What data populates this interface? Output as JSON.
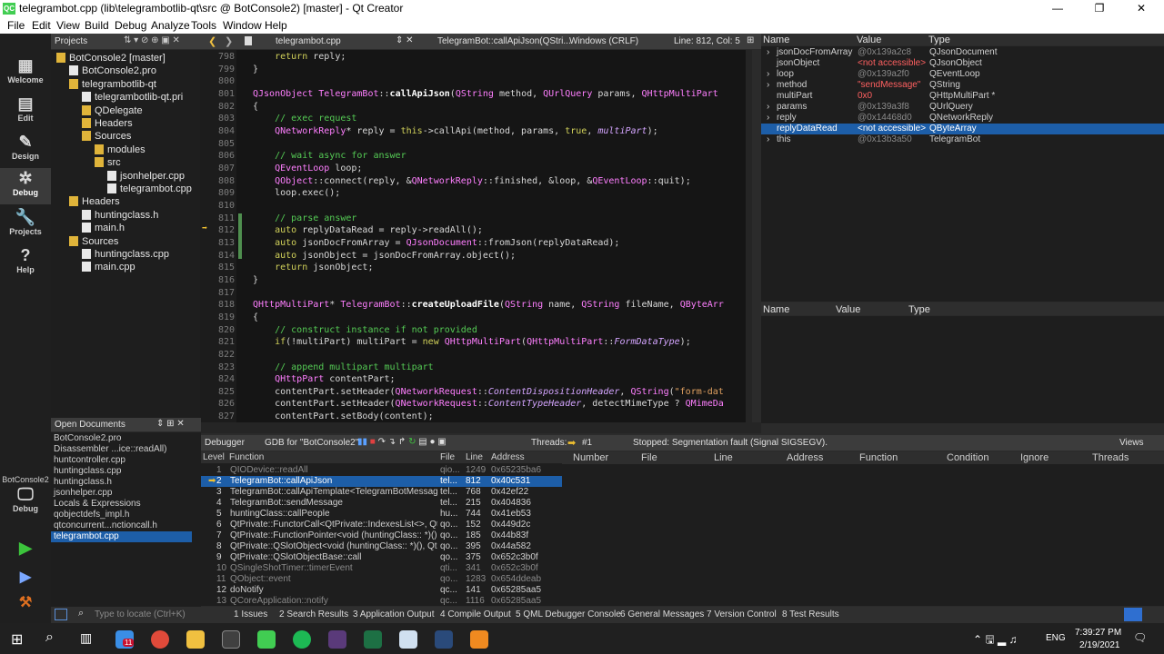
{
  "window": {
    "title": "telegrambot.cpp (lib\\telegrambotlib-qt\\src @ BotConsole2) [master] - Qt Creator",
    "logo": "QC"
  },
  "menu": [
    "File",
    "Edit",
    "View",
    "Build",
    "Debug",
    "Analyze",
    "Tools",
    "Window",
    "Help"
  ],
  "modes": [
    {
      "label": "Welcome",
      "icon": "▦"
    },
    {
      "label": "Edit",
      "icon": "▤"
    },
    {
      "label": "Design",
      "icon": "✎"
    },
    {
      "label": "Debug",
      "icon": "✲"
    },
    {
      "label": "Projects",
      "icon": "🔧"
    },
    {
      "label": "Help",
      "icon": "?"
    }
  ],
  "kit": {
    "name": "BotConsole2",
    "mode": "Debug"
  },
  "projects": {
    "label": "Projects",
    "tree": [
      {
        "t": "BotConsole2 [master]",
        "d": 0,
        "k": "folder"
      },
      {
        "t": "BotConsole2.pro",
        "d": 1,
        "k": "file"
      },
      {
        "t": "telegrambotlib-qt",
        "d": 1,
        "k": "folder"
      },
      {
        "t": "telegrambotlib-qt.pri",
        "d": 2,
        "k": "file"
      },
      {
        "t": "QDelegate",
        "d": 2,
        "k": "folder"
      },
      {
        "t": "Headers",
        "d": 2,
        "k": "folder"
      },
      {
        "t": "Sources",
        "d": 2,
        "k": "folder"
      },
      {
        "t": "modules",
        "d": 3,
        "k": "folder"
      },
      {
        "t": "src",
        "d": 3,
        "k": "folder"
      },
      {
        "t": "jsonhelper.cpp",
        "d": 4,
        "k": "file"
      },
      {
        "t": "telegrambot.cpp",
        "d": 4,
        "k": "file"
      },
      {
        "t": "Headers",
        "d": 1,
        "k": "folder"
      },
      {
        "t": "huntingclass.h",
        "d": 2,
        "k": "file"
      },
      {
        "t": "main.h",
        "d": 2,
        "k": "file"
      },
      {
        "t": "Sources",
        "d": 1,
        "k": "folder"
      },
      {
        "t": "huntingclass.cpp",
        "d": 2,
        "k": "file"
      },
      {
        "t": "main.cpp",
        "d": 2,
        "k": "file"
      }
    ]
  },
  "editor": {
    "file": "telegrambot.cpp",
    "func": "TelegramBot::callApiJson(QStri...",
    "eol": "Windows (CRLF)",
    "pos": "Line: 812, Col: 5"
  },
  "code": [
    {
      "n": "798",
      "h": "    <span class='kw'>return</span> reply;"
    },
    {
      "n": "799",
      "h": "}"
    },
    {
      "n": "800",
      "h": ""
    },
    {
      "n": "801",
      "h": "<span class='ty'>QJsonObject</span> <span class='ty'>TelegramBot</span>::<span class='fn'>callApiJson</span>(<span class='ty'>QString</span> method, <span class='ty'>QUrlQuery</span> params, <span class='ty'>QHttpMultiPart</span>"
    },
    {
      "n": "802",
      "h": "{"
    },
    {
      "n": "803",
      "h": "    <span class='cm'>// exec request</span>"
    },
    {
      "n": "804",
      "h": "    <span class='ty'>QNetworkReply</span>* reply = <span class='kw'>this</span>->callApi(method, params, <span class='kw'>true</span>, <span class='it'>multiPart</span>);"
    },
    {
      "n": "805",
      "h": ""
    },
    {
      "n": "806",
      "h": "    <span class='cm'>// wait async for answer</span>"
    },
    {
      "n": "807",
      "h": "    <span class='ty'>QEventLoop</span> loop;"
    },
    {
      "n": "808",
      "h": "    <span class='ty'>QObject</span>::connect(reply, &<span class='ty'>QNetworkReply</span>::finished, &loop, &<span class='ty'>QEventLoop</span>::quit);"
    },
    {
      "n": "809",
      "h": "    loop.exec();"
    },
    {
      "n": "810",
      "h": ""
    },
    {
      "n": "811",
      "h": "    <span class='cm'>// parse answer</span>"
    },
    {
      "n": "812",
      "h": "    <span class='kw'>auto</span> replyDataRead = reply->readAll();"
    },
    {
      "n": "813",
      "h": "    <span class='kw'>auto</span> jsonDocFromArray = <span class='ty'>QJsonDocument</span>::fromJson(replyDataRead);"
    },
    {
      "n": "814",
      "h": "    <span class='kw'>auto</span> jsonObject = jsonDocFromArray.object();"
    },
    {
      "n": "815",
      "h": "    <span class='kw'>return</span> jsonObject;"
    },
    {
      "n": "816",
      "h": "}"
    },
    {
      "n": "817",
      "h": ""
    },
    {
      "n": "818",
      "h": "<span class='ty'>QHttpMultiPart</span>* <span class='ty'>TelegramBot</span>::<span class='fn'>createUploadFile</span>(<span class='ty'>QString</span> name, <span class='ty'>QString</span> fileName, <span class='ty'>QByteArr</span>"
    },
    {
      "n": "819",
      "h": "{"
    },
    {
      "n": "820",
      "h": "    <span class='cm'>// construct instance if not provided</span>"
    },
    {
      "n": "821",
      "h": "    <span class='kw'>if</span>(!multiPart) multiPart = <span class='kw'>new</span> <span class='ty'>QHttpMultiPart</span>(<span class='ty'>QHttpMultiPart</span>::<span class='it'>FormDataType</span>);"
    },
    {
      "n": "822",
      "h": ""
    },
    {
      "n": "823",
      "h": "    <span class='cm'>// append multipart multipart</span>"
    },
    {
      "n": "824",
      "h": "    <span class='ty'>QHttpPart</span> contentPart;"
    },
    {
      "n": "825",
      "h": "    contentPart.setHeader(<span class='ty'>QNetworkRequest</span>::<span class='it'>ContentDispositionHeader</span>, <span class='ty'>QString</span>(<span class='st'>\"form-dat</span>"
    },
    {
      "n": "826",
      "h": "    contentPart.setHeader(<span class='ty'>QNetworkRequest</span>::<span class='it'>ContentTypeHeader</span>, detectMimeType ? <span class='ty'>QMimeDa</span>"
    },
    {
      "n": "827",
      "h": "    contentPart.setBody(content);"
    }
  ],
  "locals": {
    "headers": [
      "Name",
      "Value",
      "Type"
    ],
    "rows": [
      {
        "name": "jsonDocFromArray",
        "value": "@0x139a2c8",
        "type": "QJsonDocument",
        "arrow": "›"
      },
      {
        "name": "jsonObject",
        "value": "<not accessible>",
        "type": "QJsonObject",
        "arrow": "",
        "red": true
      },
      {
        "name": "loop",
        "value": "@0x139a2f0",
        "type": "QEventLoop",
        "arrow": "›"
      },
      {
        "name": "method",
        "value": "\"sendMessage\"",
        "type": "QString",
        "arrow": "›",
        "red": true
      },
      {
        "name": "multiPart",
        "value": "0x0",
        "type": "QHttpMultiPart *",
        "arrow": "",
        "red": true
      },
      {
        "name": "params",
        "value": "@0x139a3f8",
        "type": "QUrlQuery",
        "arrow": "›"
      },
      {
        "name": "reply",
        "value": "@0x14468d0",
        "type": "QNetworkReply",
        "arrow": "›"
      },
      {
        "name": "replyDataRead",
        "value": "<not accessible>",
        "type": "QByteArray",
        "arrow": "",
        "sel": true
      },
      {
        "name": "this",
        "value": "@0x13b3a50",
        "type": "TelegramBot",
        "arrow": "›"
      }
    ]
  },
  "watch": {
    "headers": [
      "Name",
      "Value",
      "Type"
    ]
  },
  "opendocs": {
    "label": "Open Documents",
    "items": [
      "BotConsole2.pro",
      "Disassembler ...ice::readAll)",
      "huntcontroller.cpp",
      "huntingclass.cpp",
      "huntingclass.h",
      "jsonhelper.cpp",
      "Locals & Expressions",
      "qobjectdefs_impl.h",
      "qtconcurrent...nctioncall.h",
      "telegrambot.cpp"
    ],
    "selected": 9
  },
  "debugbar": {
    "label": "Debugger",
    "engine": "GDB for \"BotConsole2\"",
    "threads_label": "Threads:",
    "thread": "#1",
    "status": "Stopped: Segmentation fault (Signal SIGSEGV).",
    "views": "Views"
  },
  "stack": {
    "headers": [
      "Level",
      "Function",
      "File",
      "Line",
      "Address"
    ],
    "rows": [
      {
        "level": "1",
        "func": "QIODevice::readAll",
        "file": "qio...",
        "line": "1249",
        "addr": "0x65235ba6",
        "gray": true
      },
      {
        "level": "2",
        "func": "TelegramBot::callApiJson",
        "file": "tel...",
        "line": "812",
        "addr": "0x40c531",
        "sel": true
      },
      {
        "level": "3",
        "func": "TelegramBot::callApiTemplate<TelegramBotMessag...",
        "file": "tel...",
        "line": "768",
        "addr": "0x42ef22"
      },
      {
        "level": "4",
        "func": "TelegramBot::sendMessage",
        "file": "tel...",
        "line": "215",
        "addr": "0x404836"
      },
      {
        "level": "5",
        "func": "huntingClass::callPeople",
        "file": "hu...",
        "line": "744",
        "addr": "0x41eb53"
      },
      {
        "level": "6",
        "func": "QtPrivate::FunctorCall<QtPrivate::IndexesList<>, Qt...",
        "file": "qo...",
        "line": "152",
        "addr": "0x449d2c"
      },
      {
        "level": "7",
        "func": "QtPrivate::FunctionPointer<void (huntingClass:: *)()...",
        "file": "qo...",
        "line": "185",
        "addr": "0x44b83f"
      },
      {
        "level": "8",
        "func": "QtPrivate::QSlotObject<void (huntingClass:: *)(), Qt...",
        "file": "qo...",
        "line": "395",
        "addr": "0x44a582"
      },
      {
        "level": "9",
        "func": "QtPrivate::QSlotObjectBase::call",
        "file": "qo...",
        "line": "375",
        "addr": "0x652c3b0f"
      },
      {
        "level": "10",
        "func": "QSingleShotTimer::timerEvent",
        "file": "qti...",
        "line": "341",
        "addr": "0x652c3b0f",
        "gray": true
      },
      {
        "level": "11",
        "func": "QObject::event",
        "file": "qo...",
        "line": "1283",
        "addr": "0x654ddeab",
        "gray": true
      },
      {
        "level": "12",
        "func": "doNotify",
        "file": "qc...",
        "line": "141",
        "addr": "0x65285aa5"
      },
      {
        "level": "13",
        "func": "QCoreApplication::notify",
        "file": "qc...",
        "line": "1116",
        "addr": "0x65285aa5",
        "gray": true
      }
    ]
  },
  "breakpoints": {
    "headers": [
      "Number",
      "File",
      "Line",
      "Address",
      "Function",
      "Condition",
      "Ignore",
      "Threads"
    ]
  },
  "output": {
    "locator": "Type to locate (Ctrl+K)",
    "tabs": [
      "1  Issues",
      "2  Search Results",
      "3  Application Output",
      "4  Compile Output",
      "5  QML Debugger Console",
      "6  General Messages",
      "7  Version Control",
      "8  Test Results"
    ]
  },
  "taskbar": {
    "time": "7:39:27 PM",
    "date": "2/19/2021",
    "lang": "ENG",
    "badge": "11"
  }
}
